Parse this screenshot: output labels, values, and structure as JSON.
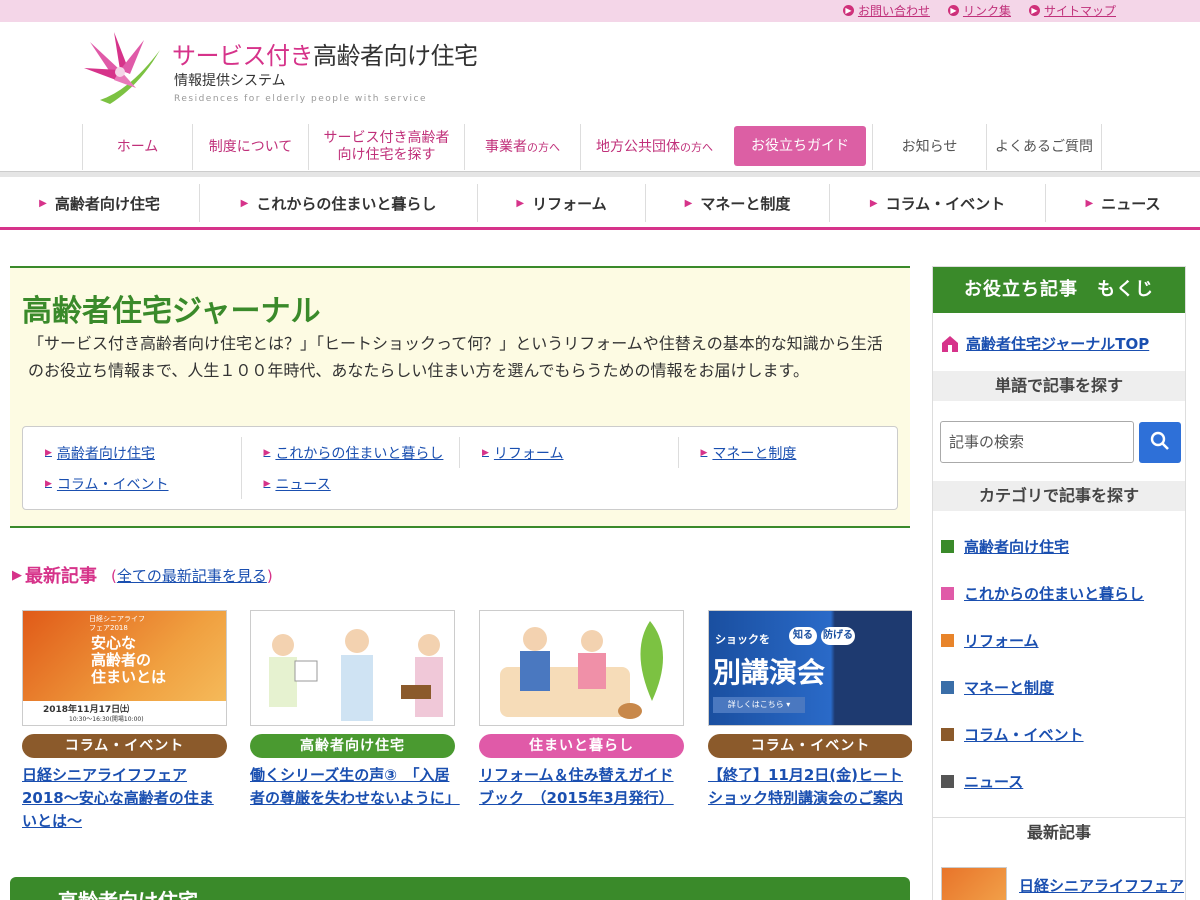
{
  "util_links": [
    "お問い合わせ",
    "リンク集",
    "サイトマップ"
  ],
  "logo": {
    "title_pink": "サービス付き",
    "title_rest": "高齢者向け住宅",
    "subtitle": "情報提供システム",
    "english": "Residences for elderly people with service"
  },
  "gnav": {
    "home": "ホーム",
    "system": "制度について",
    "search_l1": "サービス付き高齢者",
    "search_l2": "向け住宅を探す",
    "business": "事業者",
    "business_small": "の方へ",
    "local_gov": "地方公共団体",
    "local_gov_small": "の方へ",
    "guide": "お役立ちガイド",
    "news": "お知らせ",
    "faq": "よくあるご質問"
  },
  "categories": [
    "高齢者向け住宅",
    "これからの住まいと暮らし",
    "リフォーム",
    "マネーと制度",
    "コラム・イベント",
    "ニュース"
  ],
  "journal": {
    "title": "高齢者住宅ジャーナル",
    "description": "「サービス付き高齢者向け住宅とは？」「ヒートショックって何？」というリフォームや住替えの基本的な知識から生活のお役立ち情報まで、人生１００年時代、あなたらしい住まい方を選んでもらうための情報をお届けします。",
    "links": [
      "高齢者向け住宅",
      "これからの住まいと暮らし",
      "リフォーム",
      "マネーと制度",
      "コラム・イベント",
      "ニュース"
    ]
  },
  "latest": {
    "title": "最新記事",
    "open_paren": "(",
    "all_link": "全ての最新記事を見る",
    "close_paren": ")",
    "cards": [
      {
        "tag": "コラム・イベント",
        "tag_color": "#8b5a2b",
        "title": "日経シニアライフフェア2018〜安心な高齢者の住まいとは〜",
        "thumb_l1": "日経シニアライフ",
        "thumb_l2": "フェア2018",
        "thumb_main1": "安心な",
        "thumb_main2": "高齢者の",
        "thumb_main3": "住まいとは",
        "thumb_date": "2018年11月17日㈯",
        "thumb_time": "10:30〜16:30(開場10:00)"
      },
      {
        "tag": "高齢者向け住宅",
        "tag_color": "#4a9a30",
        "title": "働くシリーズ生の声③　「入居者の尊厳を失わせないように」"
      },
      {
        "tag": "住まいと暮らし",
        "tag_color": "#e05aa8",
        "title": "リフォーム＆住み替えガイドブック　（2015年3月発行）"
      },
      {
        "tag": "コラム・イベント",
        "tag_color": "#8b5a2b",
        "title": "【終了】11月2日(金)ヒートショック特別講演会のご案内",
        "thumb_a": "ショックを",
        "thumb_b": "知る",
        "thumb_c": "防げる",
        "thumb_main": "別講演会",
        "thumb_link": "詳しくはこちら ▾"
      }
    ]
  },
  "next_section": "高齢者向け住宅",
  "sidebar": {
    "head": "お役立ち記事　もくじ",
    "top_link": "高齢者住宅ジャーナルTOP",
    "search_head": "単語で記事を探す",
    "search_placeholder": "記事の検索",
    "category_head": "カテゴリで記事を探す",
    "categories": [
      {
        "label": "高齢者向け住宅",
        "color": "#3a8a2a"
      },
      {
        "label": "これからの住まいと暮らし",
        "color": "#e05aa8"
      },
      {
        "label": "リフォーム",
        "color": "#e8842a"
      },
      {
        "label": "マネーと制度",
        "color": "#3a6ea8"
      },
      {
        "label": "コラム・イベント",
        "color": "#8b5a2b"
      },
      {
        "label": "ニュース",
        "color": "#555555"
      }
    ],
    "latest_head": "最新記事",
    "latest_item": "日経シニアライフフェア"
  }
}
